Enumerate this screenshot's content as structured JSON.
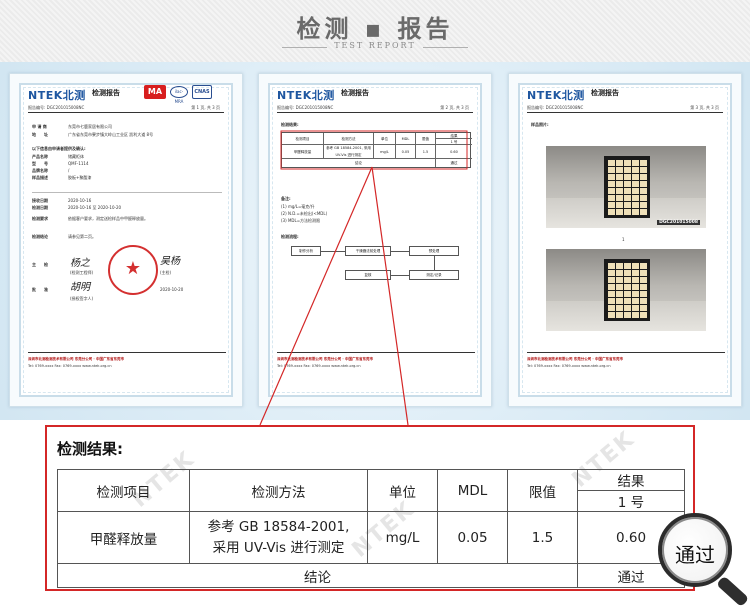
{
  "header": {
    "title": "检测 ▪ 报告",
    "subtitle": "TEST REPORT"
  },
  "doc1": {
    "logo": "NTEK北测",
    "title": "检测报告",
    "badges": {
      "ma": "MA",
      "ilac": "ilac-MRA",
      "cnas": "CNAS"
    },
    "report_no": "报告编号: DGC201015008NC",
    "page": "第 1 页, 共 3 页",
    "rows": [
      {
        "label": "申 请 商",
        "value": "东莞市七鹿家居有限公司"
      },
      {
        "label": "地　　址",
        "value": "广东省东莞市寮步镇大岭山工业区 凯利大道 8号"
      },
      {
        "label": "以下信息由申请者提供及确认:",
        "value": ""
      },
      {
        "label": "产品名称",
        "value": "储藏柜体"
      },
      {
        "label": "型　　号",
        "value": "QMF-1114"
      },
      {
        "label": "品牌名称",
        "value": "/"
      },
      {
        "label": "样品描述",
        "value": "胶板+聚酯漆"
      },
      {
        "label": "接收日期",
        "value": "2020-10-16"
      },
      {
        "label": "检测日期",
        "value": "2020-10-16 至 2020-10-20"
      },
      {
        "label": "检测要求",
        "value": "依据客户要求，测定送检样品中甲醛释放量。"
      },
      {
        "label": "检测结论",
        "value": "请参见第二页。"
      }
    ],
    "sig_label_1": "主　　检",
    "sig_label_2": "批　　准",
    "sig_caption_1": "(检测工程师)",
    "sig_caption_2": "(授权签字人)",
    "sig_caption_3": "(主检)",
    "sig_date": "2020-10-20",
    "sig_text_1": "杨之",
    "sig_text_2": "胡明",
    "sig_text_3": "吴杨"
  },
  "doc2": {
    "logo": "NTEK北测",
    "title": "检测报告",
    "report_no": "报告编号: DGC201015008NC",
    "page": "第 2 页, 共 3 页",
    "section": "检测结果:",
    "mini_headers": [
      "检测项目",
      "检测方法",
      "单位",
      "MDL",
      "限值",
      "结果"
    ],
    "mini_row": [
      "甲醛释放量",
      "参考 GB 18584-2001, 采用 UV-Vis 进行测定",
      "mg/L",
      "0.05",
      "1.5",
      "0.60"
    ],
    "mini_conclusion": "结论",
    "mini_pass": "通过",
    "mini_sample": "1 号",
    "note_title": "备注:",
    "notes": [
      "(1) mg/L=毫克/升",
      "(2) N.D.=未检出(<MDL)",
      "(3) MDL=方法检测限"
    ],
    "flow_title": "检测流程:",
    "flow_boxes": [
      "制作分析",
      "干燥器法前处理",
      "预处理",
      "测定/记录",
      "复核",
      "报告"
    ]
  },
  "doc3": {
    "logo": "NTEK北测",
    "title": "检测报告",
    "report_no": "报告编号: DGC201015008NC",
    "page": "第 3 页, 共 3 页",
    "section": "样品照片:",
    "photo_label": "DGC201015008",
    "photo_marker": "1"
  },
  "footer": {
    "red_line": "深圳市北测检测技术有限公司 东莞分公司 · 中国广东省东莞市",
    "blk_line": "Tel: 0769-xxxx  Fax: 0769-xxxx  www.ntek.org.cn"
  },
  "result": {
    "title": "检测结果:",
    "headers": {
      "item": "检测项目",
      "method": "检测方法",
      "unit": "单位",
      "mdl": "MDL",
      "limit": "限值",
      "result": "结果",
      "sample": "1 号"
    },
    "row": {
      "item": "甲醛释放量",
      "method_line1": "参考 GB 18584-2001,",
      "method_line2": "采用 UV-Vis 进行测定",
      "unit": "mg/L",
      "mdl": "0.05",
      "limit": "1.5",
      "result": "0.60"
    },
    "conclusion_label": "结论",
    "conclusion_value": "通过"
  },
  "magnifier": {
    "text": "通过"
  },
  "watermark": "NTEK",
  "colors": {
    "accent_red": "#d42727",
    "brand_blue": "#1e56a0",
    "band_blue": "#dcecf6"
  }
}
